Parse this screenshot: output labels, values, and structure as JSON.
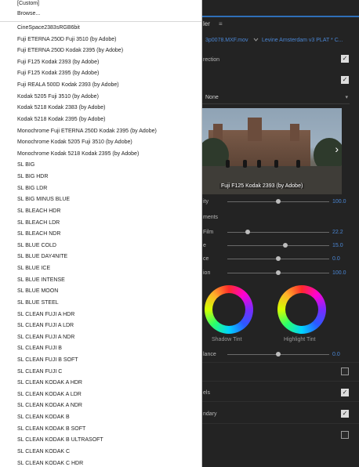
{
  "panel": {
    "tab_label": "ler",
    "menu_icon": "hamburger-icon",
    "clip_name": "3p0078.MXF.mov",
    "sequence_name": "Levine Amsterdam v3 PLAT * C...",
    "rows": {
      "rection_label": "rection",
      "none_value": "None",
      "preview_caption": "Fuji F125 Kodak 2393 (by Adobe)",
      "ity_label": "ity",
      "ity_value": "100.0",
      "ments_label": "ments",
      "film_label": "Film",
      "film_value": "22.2",
      "e_label": "e",
      "e_value": "15.0",
      "ce_label": "ce",
      "ce_value": "0.0",
      "ion_label": "ion",
      "ion_value": "100.0",
      "shadow_tint": "Shadow Tint",
      "highlight_tint": "Highlight Tint",
      "lance_label": "lance",
      "lance_value": "0.0",
      "els_label": "els",
      "ndary_label": "ndary"
    },
    "checkboxes": {
      "top": true,
      "direction": true,
      "lower1": false,
      "lower2": true,
      "lower3": true,
      "lower4": false
    },
    "sliders": {
      "ity": 0.5,
      "film": 0.2,
      "e": 0.57,
      "ce": 0.5,
      "ion": 0.5,
      "lance": 0.5
    },
    "accent_color": "#4a86d4"
  },
  "menu": {
    "top_items": [
      "[Custom]",
      "Browse..."
    ],
    "items": [
      "CineSpace2383sRGB6bit",
      "Fuji ETERNA 250D Fuji 3510 (by Adobe)",
      "Fuji ETERNA 250D Kodak 2395 (by Adobe)",
      "Fuji F125 Kodak 2393 (by Adobe)",
      "Fuji F125 Kodak 2395 (by Adobe)",
      "Fuji REALA 500D Kodak 2393 (by Adobe)",
      "Kodak 5205 Fuji 3510 (by Adobe)",
      "Kodak 5218 Kodak 2383 (by Adobe)",
      "Kodak 5218 Kodak 2395 (by Adobe)",
      "Monochrome Fuji ETERNA 250D Kodak 2395 (by Adobe)",
      "Monochrome Kodak 5205 Fuji 3510 (by Adobe)",
      "Monochrome Kodak 5218 Kodak 2395 (by Adobe)",
      "SL BIG",
      "SL BIG HDR",
      "SL BIG LDR",
      "SL BIG MINUS BLUE",
      "SL BLEACH HDR",
      "SL BLEACH LDR",
      "SL BLEACH NDR",
      "SL BLUE COLD",
      "SL BLUE DAY4NITE",
      "SL BLUE ICE",
      "SL BLUE INTENSE",
      "SL BLUE MOON",
      "SL BLUE STEEL",
      "SL CLEAN FUJI A HDR",
      "SL CLEAN FUJI A LDR",
      "SL CLEAN FUJI A NDR",
      "SL CLEAN FUJI B",
      "SL CLEAN FUJI B SOFT",
      "SL CLEAN FUJI C",
      "SL CLEAN KODAK A HDR",
      "SL CLEAN KODAK A LDR",
      "SL CLEAN KODAK A NDR",
      "SL CLEAN KODAK B",
      "SL CLEAN KODAK B SOFT",
      "SL CLEAN KODAK B ULTRASOFT",
      "SL CLEAN KODAK C",
      "SL CLEAN KODAK C HDR"
    ]
  }
}
